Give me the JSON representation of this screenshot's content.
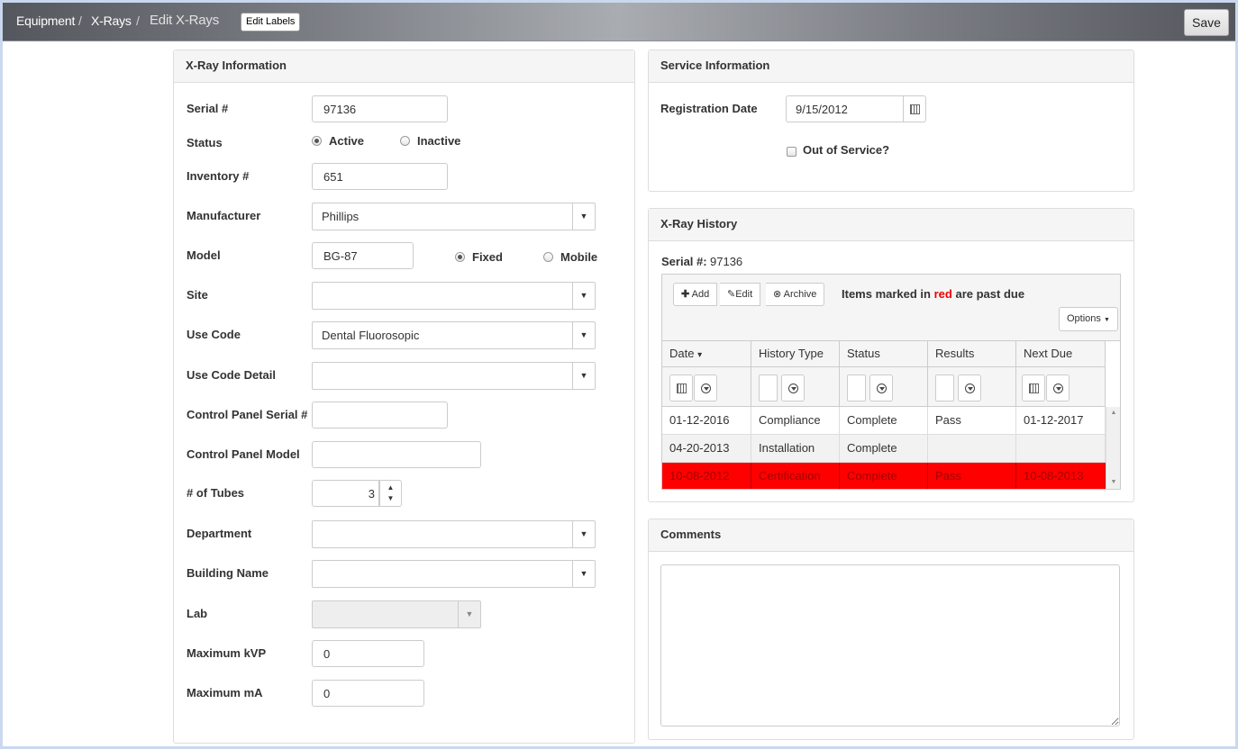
{
  "breadcrumb": {
    "item1": "Equipment",
    "item2": "X-Rays",
    "current": "Edit X-Rays",
    "sep": "/"
  },
  "edit_labels": "Edit Labels",
  "save_label": "Save",
  "xray_info": {
    "title": "X-Ray Information",
    "serial_label": "Serial #",
    "serial_value": "97136",
    "status_label": "Status",
    "status_active": "Active",
    "status_inactive": "Inactive",
    "status_selected": "Active",
    "inventory_label": "Inventory #",
    "inventory_value": "651",
    "manufacturer_label": "Manufacturer",
    "manufacturer_value": "Phillips",
    "model_label": "Model",
    "model_value": "BG-87",
    "type_fixed": "Fixed",
    "type_mobile": "Mobile",
    "type_selected": "Fixed",
    "site_label": "Site",
    "site_value": "",
    "use_code_label": "Use Code",
    "use_code_value": "Dental Fluorosopic",
    "use_code_detail_label": "Use Code Detail",
    "use_code_detail_value": "",
    "cp_serial_label": "Control Panel Serial #",
    "cp_serial_value": "",
    "cp_model_label": "Control Panel Model",
    "cp_model_value": "",
    "tubes_label": "# of Tubes",
    "tubes_value": "3",
    "department_label": "Department",
    "department_value": "",
    "building_label": "Building Name",
    "building_value": "",
    "lab_label": "Lab",
    "lab_value": "",
    "kvp_label": "Maximum kVP",
    "kvp_value": "0",
    "ma_label": "Maximum mA",
    "ma_value": "0"
  },
  "service_info": {
    "title": "Service Information",
    "reg_date_label": "Registration Date",
    "reg_date_value": "9/15/2012",
    "out_of_service_label": "Out of Service?",
    "out_of_service_checked": false
  },
  "history": {
    "title": "X-Ray History",
    "serial_label": "Serial #:",
    "serial_value": "97136",
    "add_label": "Add",
    "edit_label": "Edit",
    "archive_label": "Archive",
    "notice_pre": "Items marked in",
    "notice_red": "red",
    "notice_post": "are past due",
    "options_label": "Options",
    "columns": [
      "Date",
      "History Type",
      "Status",
      "Results",
      "Next Due"
    ],
    "sort_indicator": "▾",
    "rows": [
      {
        "date": "01-12-2016",
        "type": "Compliance",
        "status": "Complete",
        "results": "Pass",
        "next_due": "01-12-2017",
        "past_due": false
      },
      {
        "date": "04-20-2013",
        "type": "Installation",
        "status": "Complete",
        "results": "",
        "next_due": "",
        "past_due": false
      },
      {
        "date": "10-08-2012",
        "type": "Certification",
        "status": "Complete",
        "results": "Pass",
        "next_due": "10-08-2013",
        "past_due": true
      }
    ],
    "past_due_color": "#ff0000"
  },
  "comments": {
    "title": "Comments",
    "value": ""
  }
}
